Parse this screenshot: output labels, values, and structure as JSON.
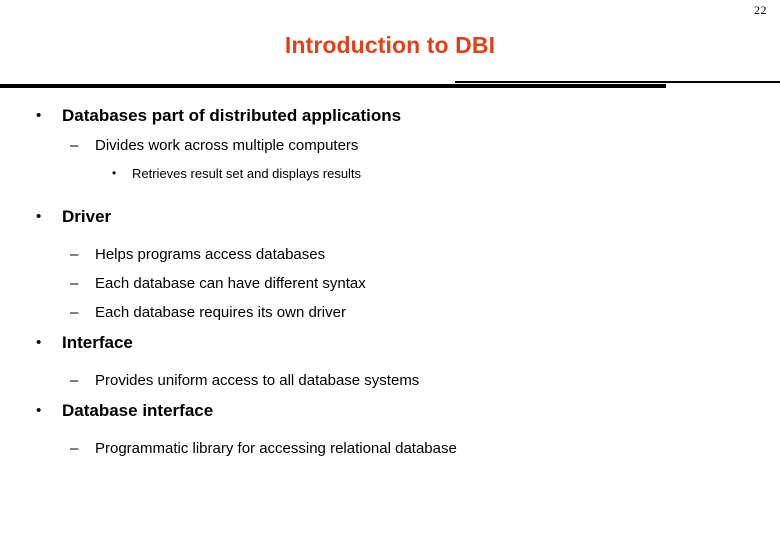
{
  "slide": {
    "page_number": "22",
    "title": "Introduction to DBI",
    "title_color": "#e2401b",
    "background_color": "#ffffff",
    "text_color": "#000000",
    "rule_color": "#000000",
    "markers": {
      "level1": "•",
      "level2": "–",
      "level3": "•"
    },
    "bullets": [
      {
        "level": 1,
        "text": "Databases part of distributed applications"
      },
      {
        "level": 2,
        "text": "Divides work across multiple computers"
      },
      {
        "level": 3,
        "text": "Retrieves result set and displays results"
      },
      {
        "level": 1,
        "text": "Driver"
      },
      {
        "level": 2,
        "text": "Helps programs access databases"
      },
      {
        "level": 2,
        "text": "Each database can have different syntax"
      },
      {
        "level": 2,
        "text": "Each database requires its own driver"
      },
      {
        "level": 1,
        "text": "Interface"
      },
      {
        "level": 2,
        "text": "Provides uniform access to all database systems"
      },
      {
        "level": 1,
        "text": "Database interface"
      },
      {
        "level": 2,
        "text": "Programmatic library for accessing relational database"
      }
    ]
  }
}
